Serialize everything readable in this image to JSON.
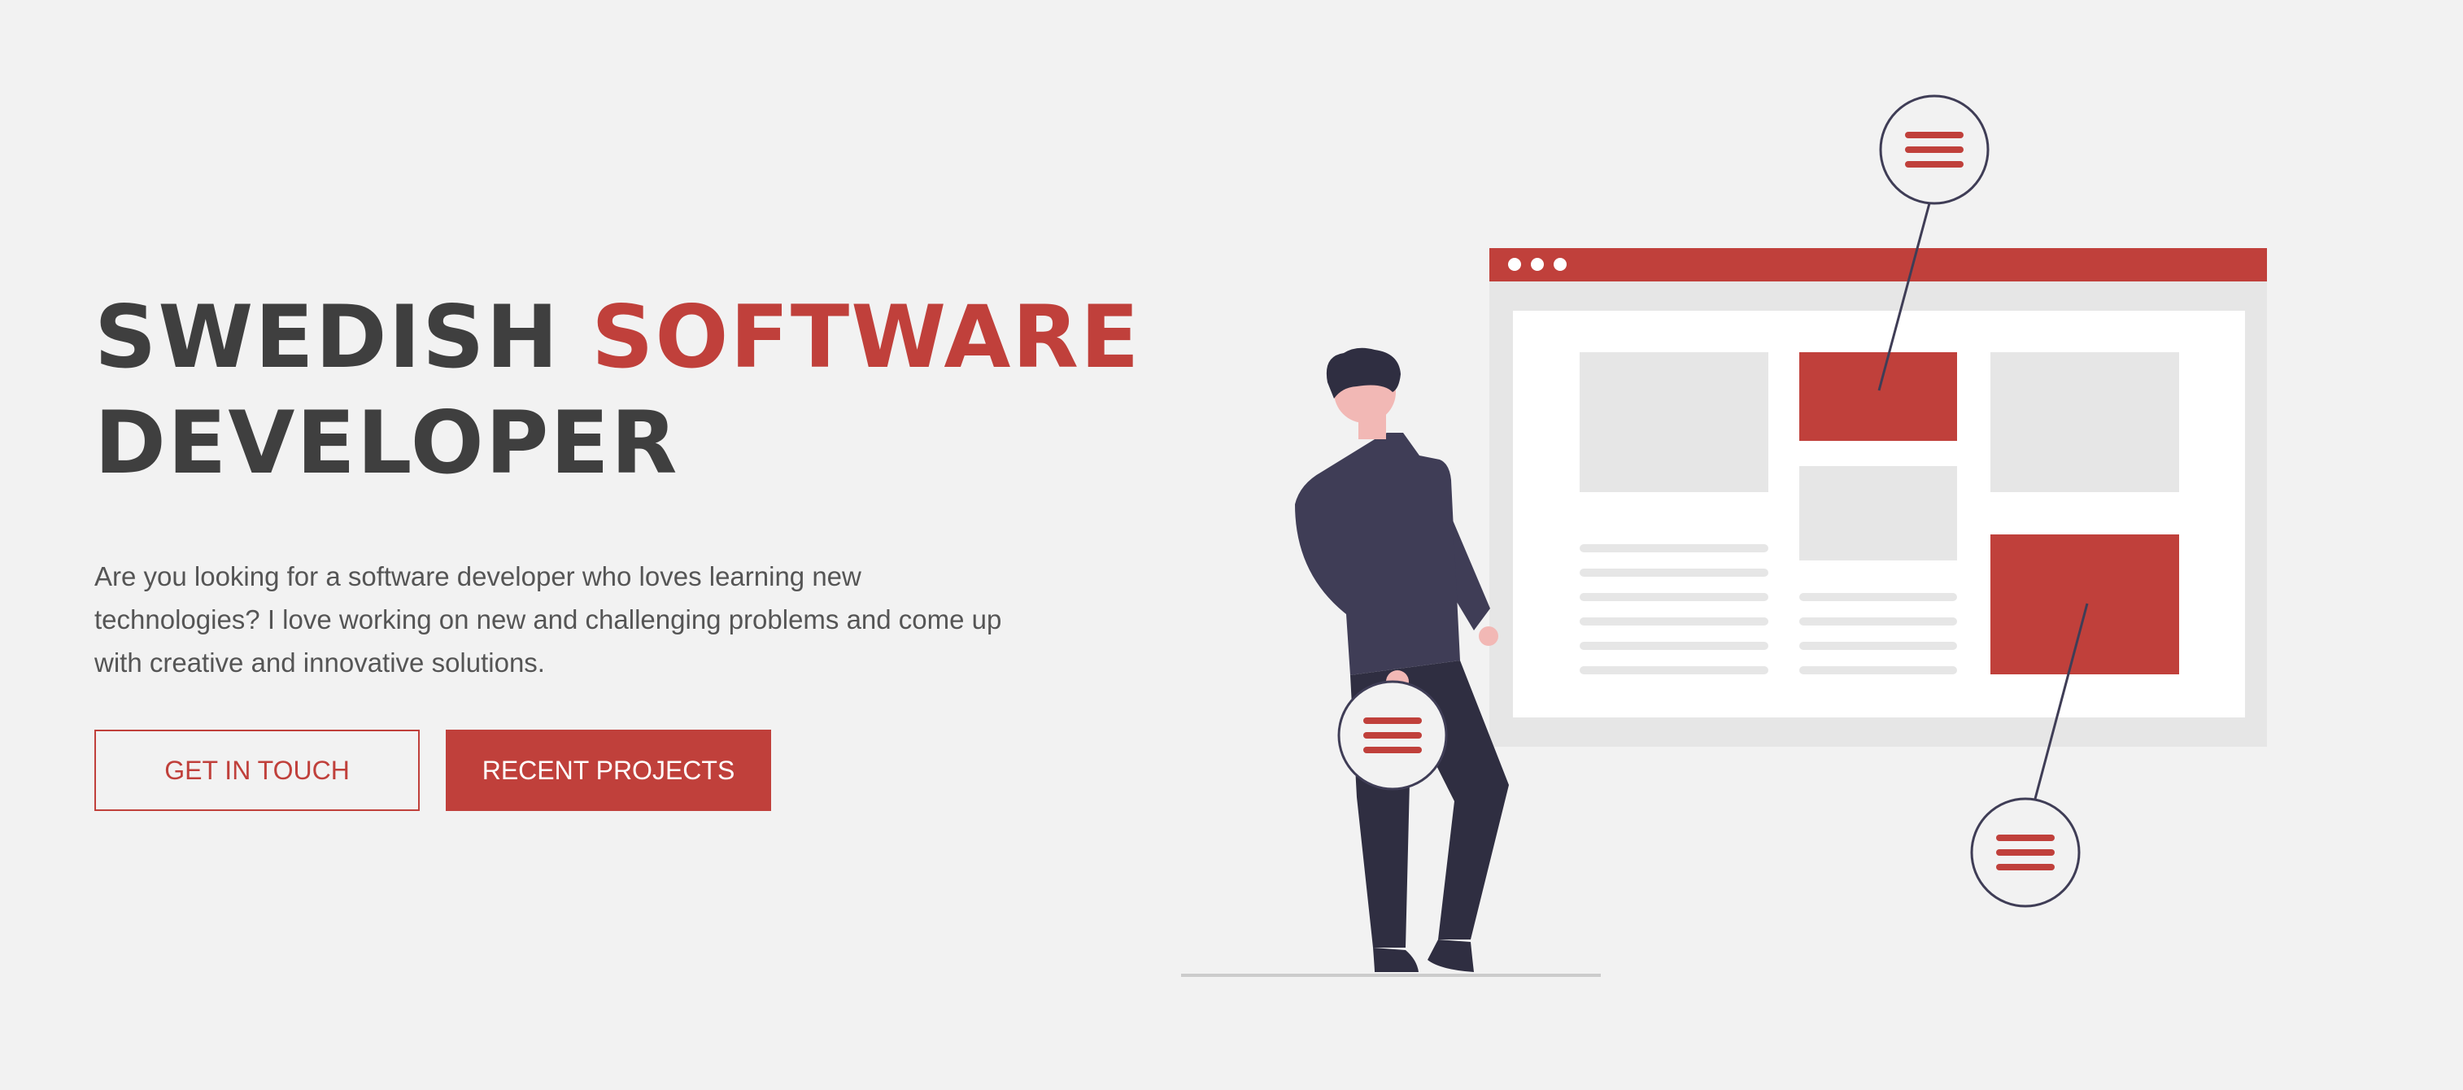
{
  "hero": {
    "headline_part1": "SWEDISH ",
    "headline_accent": "SOFTWARE",
    "headline_part2": "DEVELOPER",
    "intro": "Are you looking for a software developer who loves learning new technologies? I love working on new and challenging problems and come up with creative and innovative solutions.",
    "buttons": {
      "primary_label": "GET IN TOUCH",
      "secondary_label": "RECENT PROJECTS"
    }
  },
  "colors": {
    "accent": "#c0403b",
    "heading": "#3f3f3f",
    "body_text": "#555555",
    "background": "#f2f2f2"
  },
  "illustration": {
    "subject": "developer-with-website-mockup",
    "icons": [
      "menu-icon",
      "menu-icon",
      "menu-icon"
    ]
  }
}
